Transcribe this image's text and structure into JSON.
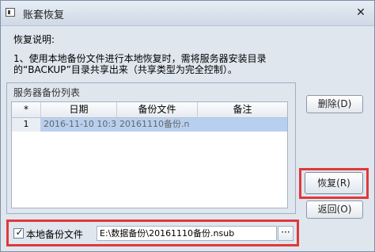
{
  "window": {
    "title": "账套恢复",
    "close_glyph": "✕"
  },
  "description": {
    "heading": "恢复说明:",
    "text": "1、使用本地备份文件进行本地恢复时，需将服务器安装目录的“BACKUP”目录共享出来（共享类型为完全控制）。"
  },
  "backup_list": {
    "group_title": "服务器备份列表",
    "columns": [
      "*",
      "日期",
      "备份文件",
      "备注"
    ],
    "rows": [
      {
        "index": "1",
        "date": "2016-11-10 10:3",
        "file": "20161110备份.n",
        "note": ""
      }
    ]
  },
  "buttons": {
    "delete": "删除(D)",
    "restore": "恢复(R)",
    "back": "返回(O)"
  },
  "local_backup": {
    "checkbox_label": "本地备份文件",
    "checked": true,
    "path": "E:\\数据备份\\20161110备份.nsub",
    "browse_label": "···"
  },
  "colors": {
    "highlight": "#e0393a",
    "selected_row": "#b8d0ef"
  }
}
